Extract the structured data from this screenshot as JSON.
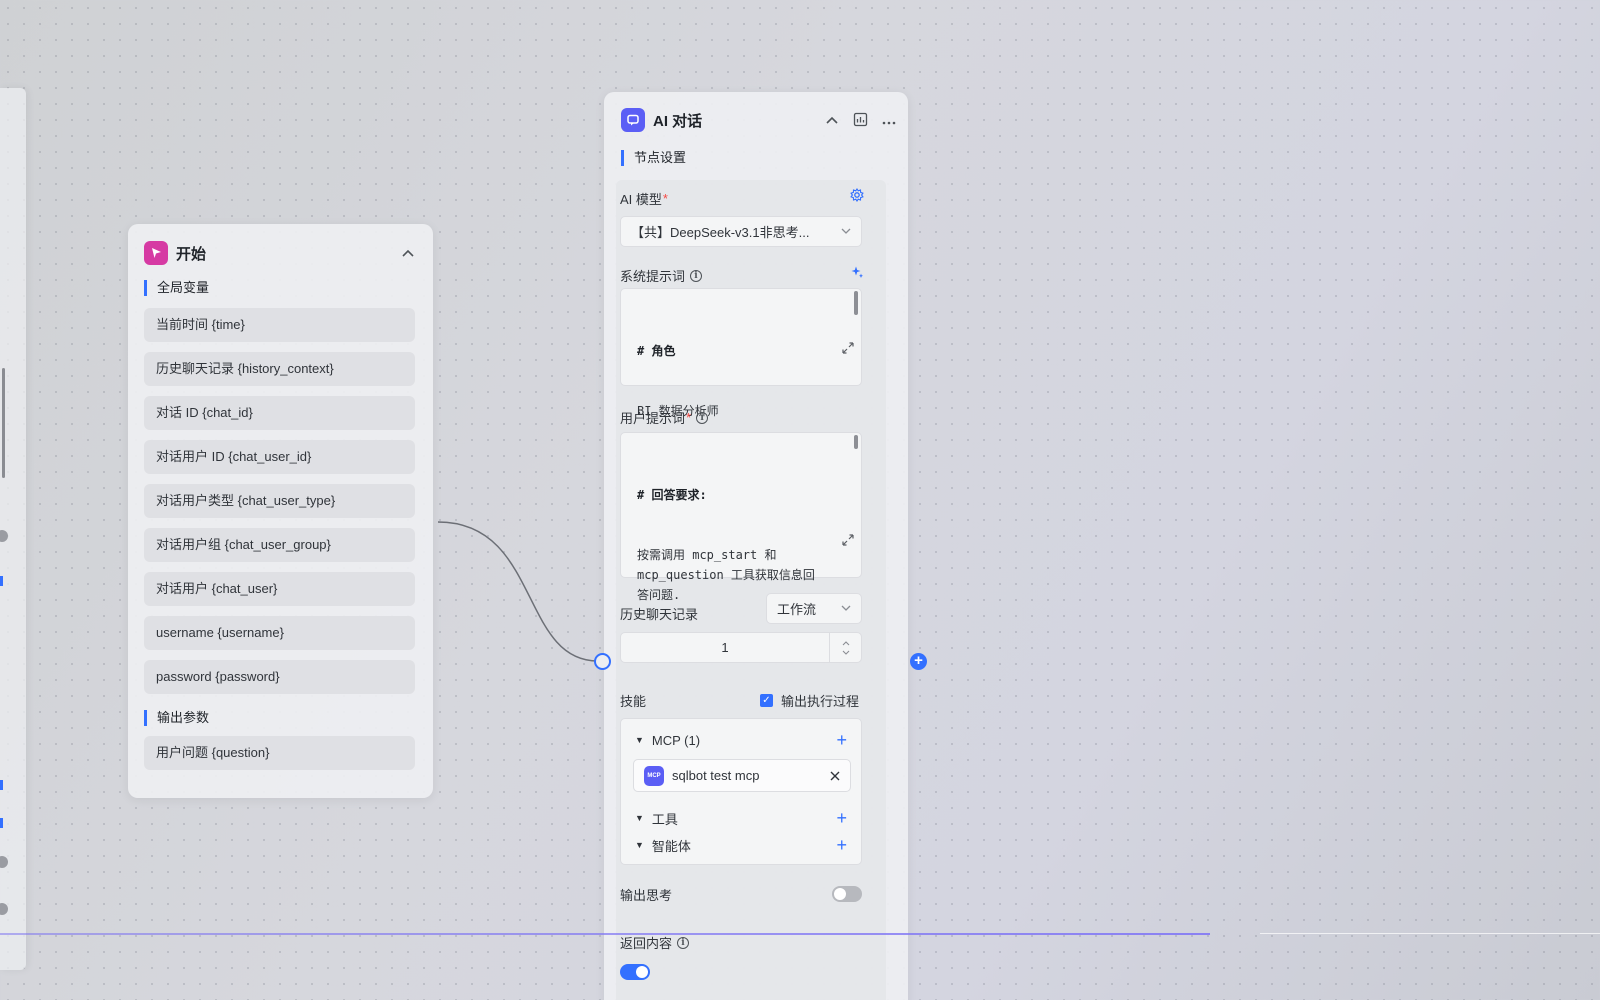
{
  "start_node": {
    "title": "开始",
    "global_vars_title": "全局变量",
    "global_vars": [
      "当前时间 {time}",
      "历史聊天记录 {history_context}",
      "对话 ID {chat_id}",
      "对话用户 ID {chat_user_id}",
      "对话用户类型 {chat_user_type}",
      "对话用户组 {chat_user_group}",
      "对话用户 {chat_user}",
      "username {username}",
      "password {password}"
    ],
    "output_title": "输出参数",
    "output_vars": [
      "用户问题 {question}"
    ]
  },
  "ai_node": {
    "title": "AI 对话",
    "section_title": "节点设置",
    "ai_model_label": "AI 模型",
    "ai_model_value": "【共】DeepSeek-v3.1非思考...",
    "system_prompt_label": "系统提示词",
    "system_prompt_heading": "# 角色",
    "system_prompt_body": "BI 数据分析师",
    "user_prompt_label": "用户提示词",
    "user_prompt_heading": "# 回答要求:",
    "user_prompt_body": "按需调用 mcp_start 和\nmcp_question 工具获取信息回\n答问题.",
    "history_label": "历史聊天记录",
    "history_select": "工作流",
    "history_count": "1",
    "skills_label": "技能",
    "output_process_label": "输出执行过程",
    "mcp_group": "MCP (1)",
    "mcp_item": "sqlbot test mcp",
    "mcp_logo_text": "MCP",
    "tools_group": "工具",
    "agents_group": "智能体",
    "output_thinking_label": "输出思考",
    "return_content_label": "返回内容",
    "output_thinking_on": false,
    "return_content_on": true,
    "output_process_checked": true
  },
  "colors": {
    "accent": "#3370ff",
    "start_icon": "#d63aa3",
    "ai_icon": "#5b5ef5"
  }
}
